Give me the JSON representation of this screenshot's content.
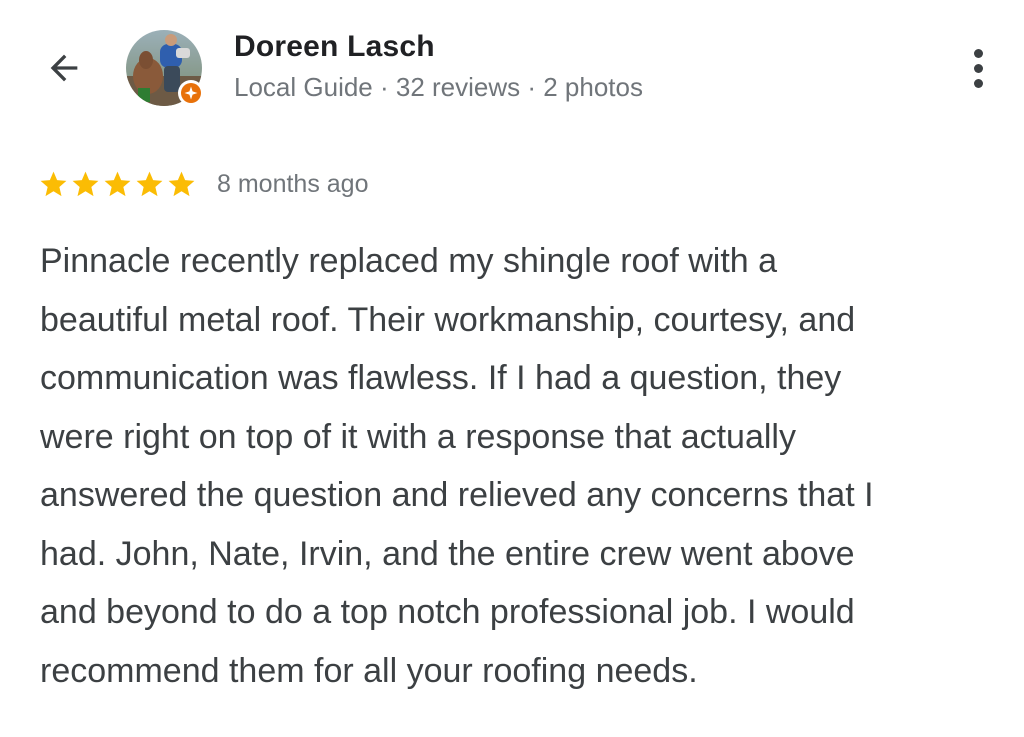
{
  "header": {
    "back_icon": "arrow-back-icon",
    "reviewer": {
      "name": "Doreen Lasch",
      "meta": "Local Guide · 32 reviews · 2 photos",
      "avatar_icon": "avatar-photo",
      "badge_icon": "local-guide-badge-icon"
    },
    "more_icon": "more-vert-icon"
  },
  "review": {
    "rating": 5,
    "rating_max": 5,
    "star_color": "#fbbc04",
    "date": "8 months ago",
    "text_lines": [
      "Pinnacle recently replaced my shingle roof with a",
      "beautiful metal roof. Their workmanship, courtesy, and",
      "communication was flawless. If I had a question, they",
      "were right on top of it with a response that actually",
      "answered the question and relieved any concerns that I",
      "had. John, Nate, Irvin, and the entire crew went above",
      "and beyond to do a top notch professional job. I would",
      "recommend them for all your roofing needs."
    ]
  },
  "colors": {
    "primary_text": "#202124",
    "body_text": "#3c4043",
    "secondary_text": "#70757a",
    "badge_orange": "#e8710a"
  }
}
